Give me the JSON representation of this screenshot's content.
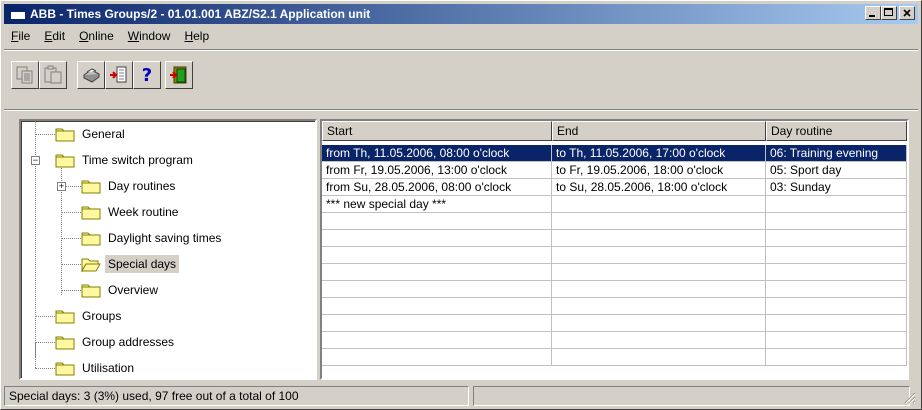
{
  "window": {
    "title": "ABB - Times Groups/2 - 01.01.001 ABZ/S2.1 Application unit",
    "minimize_icon": "minimize-icon",
    "maximize_icon": "maximize-icon",
    "close_icon": "close-icon"
  },
  "menu": [
    {
      "label": "File",
      "u": "F",
      "rest": "ile"
    },
    {
      "label": "Edit",
      "u": "E",
      "rest": "dit"
    },
    {
      "label": "Online",
      "u": "O",
      "rest": "nline"
    },
    {
      "label": "Window",
      "u": "W",
      "rest": "indow"
    },
    {
      "label": "Help",
      "u": "H",
      "rest": "elp"
    }
  ],
  "toolbar": {
    "copy_icon": "copy-icon",
    "paste_icon": "paste-icon",
    "print_icon": "print-icon",
    "import_icon": "import-icon",
    "help_icon": "help-icon",
    "exit_icon": "exit-icon",
    "help_glyph": "?"
  },
  "tree": {
    "items": [
      {
        "label": "General"
      },
      {
        "label": "Time switch program",
        "expander": "−"
      },
      {
        "label": "Day routines",
        "expander": "+"
      },
      {
        "label": "Week routine"
      },
      {
        "label": "Daylight saving times"
      },
      {
        "label": "Special days"
      },
      {
        "label": "Overview"
      },
      {
        "label": "Groups"
      },
      {
        "label": "Group addresses"
      },
      {
        "label": "Utilisation"
      }
    ]
  },
  "table": {
    "columns": [
      "Start",
      "End",
      "Day routine"
    ],
    "rows": [
      [
        "from Th, 11.05.2006, 08:00 o'clock",
        "to Th, 11.05.2006, 17:00 o'clock",
        "06: Training evening"
      ],
      [
        "from Fr, 19.05.2006, 13:00 o'clock",
        "to Fr, 19.05.2006, 18:00 o'clock",
        "05: Sport day"
      ],
      [
        "from Su, 28.05.2006, 08:00 o'clock",
        "to Su, 28.05.2006, 18:00 o'clock",
        "03: Sunday"
      ],
      [
        "*** new special day ***",
        "",
        ""
      ]
    ]
  },
  "status": {
    "text": "Special days: 3 (3%) used, 97 free out of a total of 100"
  }
}
